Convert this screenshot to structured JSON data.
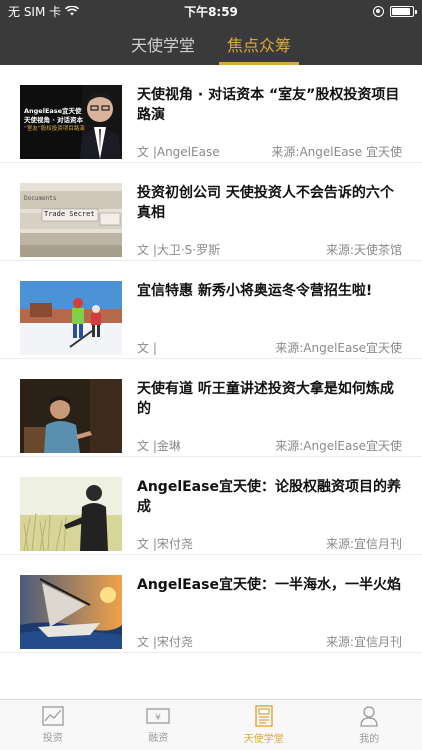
{
  "status": {
    "carrier": "无 SIM 卡",
    "time": "下午8:59",
    "battery_level": 0.9
  },
  "nav": {
    "tabs": [
      {
        "label": "天使学堂"
      },
      {
        "label": "焦点众筹"
      }
    ],
    "active": 1
  },
  "articles": [
    {
      "title": "天使视角 · 对话资本 “室友”股权投资项目路演",
      "author": "文 |AngelEase",
      "source": "来源:AngelEase 宜天使",
      "thumb": "portrait-speaker"
    },
    {
      "title": "投资初创公司 天使投资人不会告诉的六个真相",
      "author": "文 |大卫·S·罗斯",
      "source": "来源:天使茶馆",
      "thumb": "folders-trade-secret"
    },
    {
      "title": "宜信特惠 新秀小将奥运冬令营招生啦!",
      "author": "文 |",
      "source": "来源:AngelEase宜天使",
      "thumb": "ski-kids"
    },
    {
      "title": "天使有道 听王童讲述投资大拿是如何炼成的",
      "author": "文 |金琳",
      "source": "来源:AngelEase宜天使",
      "thumb": "man-seated"
    },
    {
      "title": "AngelEase宜天使：论股权融资项目的养成",
      "author": "文 |宋付尧",
      "source": "来源:宜信月刊",
      "thumb": "wheat-field"
    },
    {
      "title": "AngelEase宜天使：一半海水，一半火焰",
      "author": "文 |宋付尧",
      "source": "来源:宜信月刊",
      "thumb": "sailboat-sunset"
    }
  ],
  "thumb1_text": {
    "line1": "AngelEase宜天使",
    "line2": "天使视角 · 对话资本",
    "line3": "“室友”股权投资项目路演"
  },
  "thumb2_text": {
    "doc": "Documents",
    "tab": "Trade Secret"
  },
  "tabbar": {
    "items": [
      {
        "label": "投资",
        "icon": "chart-icon"
      },
      {
        "label": "融资",
        "icon": "money-icon"
      },
      {
        "label": "天使学堂",
        "icon": "newspaper-icon"
      },
      {
        "label": "我的",
        "icon": "user-icon"
      }
    ],
    "active": 2
  },
  "colors": {
    "accent": "#d9a93b",
    "header": "#3a3a3a"
  }
}
